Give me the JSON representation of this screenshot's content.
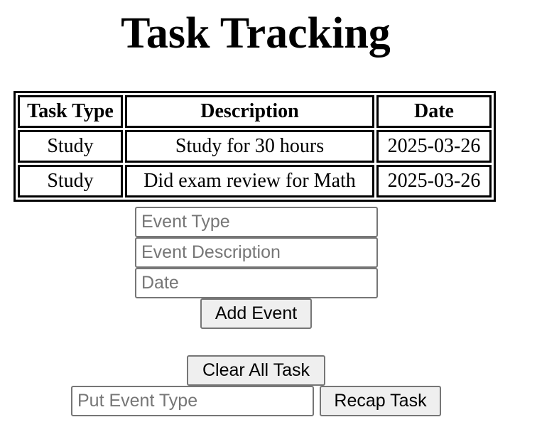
{
  "page": {
    "title": "Task Tracking"
  },
  "table": {
    "headers": [
      "Task Type",
      "Description",
      "Date"
    ],
    "rows": [
      [
        "Study",
        "Study for 30 hours",
        "2025-03-26"
      ],
      [
        "Study",
        "Did exam review for Math",
        "2025-03-26"
      ]
    ]
  },
  "form": {
    "event_type_placeholder": "Event Type",
    "event_description_placeholder": "Event Description",
    "date_placeholder": "Date",
    "add_button_label": "Add Event"
  },
  "actions": {
    "clear_button_label": "Clear All Task",
    "recap_input_placeholder": "Put Event Type",
    "recap_button_label": "Recap Task"
  }
}
